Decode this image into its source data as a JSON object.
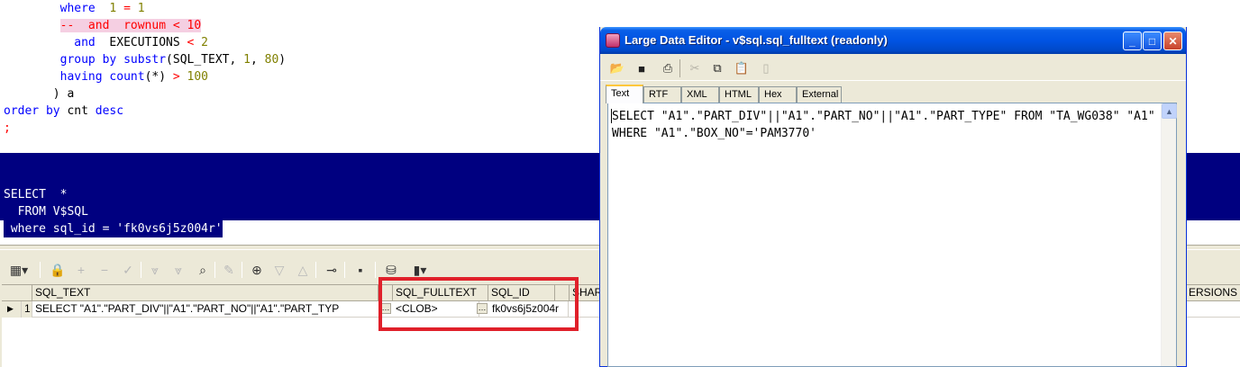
{
  "editor": {
    "lines": [
      {
        "indent": "        ",
        "parts": [
          {
            "c": "kw",
            "t": "where  "
          },
          {
            "c": "num",
            "t": "1"
          },
          {
            "c": "op",
            "t": " = "
          },
          {
            "c": "num",
            "t": "1"
          }
        ]
      },
      {
        "indent": "        ",
        "parts": [
          {
            "c": "cmt",
            "t": "--  and  rownum < 10"
          }
        ]
      },
      {
        "indent": "          ",
        "parts": [
          {
            "c": "kw",
            "t": "and  "
          },
          {
            "c": "tx",
            "t": "EXECUTIONS "
          },
          {
            "c": "op",
            "t": "< "
          },
          {
            "c": "num",
            "t": "2"
          }
        ]
      },
      {
        "indent": "        ",
        "parts": [
          {
            "c": "kw",
            "t": "group by "
          },
          {
            "c": "kw",
            "t": "substr"
          },
          {
            "c": "tx",
            "t": "("
          },
          {
            "c": "tx",
            "t": "SQL_TEXT, "
          },
          {
            "c": "num",
            "t": "1"
          },
          {
            "c": "tx",
            "t": ", "
          },
          {
            "c": "num",
            "t": "80"
          },
          {
            "c": "tx",
            "t": ")"
          }
        ]
      },
      {
        "indent": "        ",
        "parts": [
          {
            "c": "kw",
            "t": "having "
          },
          {
            "c": "kw",
            "t": "count"
          },
          {
            "c": "tx",
            "t": "(*) "
          },
          {
            "c": "op",
            "t": "> "
          },
          {
            "c": "num",
            "t": "100"
          }
        ]
      },
      {
        "indent": "       ",
        "parts": [
          {
            "c": "tx",
            "t": ") a"
          }
        ]
      },
      {
        "indent": "",
        "parts": [
          {
            "c": "kw",
            "t": "order by "
          },
          {
            "c": "tx",
            "t": "cnt "
          },
          {
            "c": "kw",
            "t": "desc"
          }
        ]
      },
      {
        "indent": "",
        "parts": [
          {
            "c": "op",
            "t": ";"
          }
        ]
      }
    ],
    "selected_lines": [
      "SELECT  *",
      "  FROM V$SQL",
      " where sql_id = 'fk0vs6j5z004r'"
    ]
  },
  "results_toolbar": {
    "icons": [
      {
        "name": "grid-view-icon",
        "glyph": "▦▾",
        "dim": false
      },
      {
        "name": "lock-icon",
        "glyph": "🔒",
        "dim": false
      },
      {
        "name": "add-record-icon",
        "glyph": "+",
        "dim": true
      },
      {
        "name": "delete-record-icon",
        "glyph": "−",
        "dim": true
      },
      {
        "name": "post-edit-icon",
        "glyph": "✓",
        "dim": true
      },
      {
        "name": "fetch-next-icon",
        "glyph": "⩔",
        "dim": true
      },
      {
        "name": "fetch-all-icon",
        "glyph": "⩔",
        "dim": true
      },
      {
        "name": "find-icon",
        "glyph": "⌕",
        "dim": false
      },
      {
        "name": "clear-icon",
        "glyph": "✎",
        "dim": true
      },
      {
        "name": "query-by-example-icon",
        "glyph": "⊕",
        "dim": false
      },
      {
        "name": "sort-descending-icon",
        "glyph": "▽",
        "dim": true
      },
      {
        "name": "sort-ascending-icon",
        "glyph": "△",
        "dim": true
      },
      {
        "name": "explain-plan-icon",
        "glyph": "⊸",
        "dim": false
      },
      {
        "name": "save-icon",
        "glyph": "▪",
        "dim": false
      },
      {
        "name": "database-icon",
        "glyph": "⛁",
        "dim": false
      },
      {
        "name": "chart-icon",
        "glyph": "▮▾",
        "dim": false
      }
    ]
  },
  "grid": {
    "columns": [
      "SQL_TEXT",
      "SQL_FULLTEXT",
      "SQL_ID",
      "SHAR",
      "ERSIONS"
    ],
    "rows": [
      {
        "num": "1",
        "sql_text": "SELECT \"A1\".\"PART_DIV\"||\"A1\".\"PART_NO\"||\"A1\".\"PART_TYP",
        "sql_fulltext": "<CLOB>",
        "sql_id": "fk0vs6j5z004r"
      }
    ]
  },
  "large_data_editor": {
    "title": "Large Data Editor - v$sql.sql_fulltext (readonly)",
    "toolbar_icons": [
      {
        "name": "open-icon",
        "glyph": "📂",
        "dim": true
      },
      {
        "name": "save-icon",
        "glyph": "■",
        "dim": false
      },
      {
        "name": "print-icon",
        "glyph": "⎙",
        "dim": false
      },
      {
        "name": "cut-icon",
        "glyph": "✂",
        "dim": true
      },
      {
        "name": "copy-icon",
        "glyph": "⧉",
        "dim": false
      },
      {
        "name": "paste-icon",
        "glyph": "📋",
        "dim": true
      },
      {
        "name": "clear-icon",
        "glyph": "▯",
        "dim": true
      }
    ],
    "tabs": [
      "Text",
      "RTF",
      "XML",
      "HTML",
      "Hex",
      "External"
    ],
    "active_tab": "Text",
    "content": "SELECT \"A1\".\"PART_DIV\"||\"A1\".\"PART_NO\"||\"A1\".\"PART_TYPE\" FROM \"TA_WG038\" \"A1\" WHERE \"A1\".\"BOX_NO\"='PAM3770'",
    "window_buttons": {
      "minimize": "_",
      "maximize": "□",
      "close": "✕"
    }
  }
}
